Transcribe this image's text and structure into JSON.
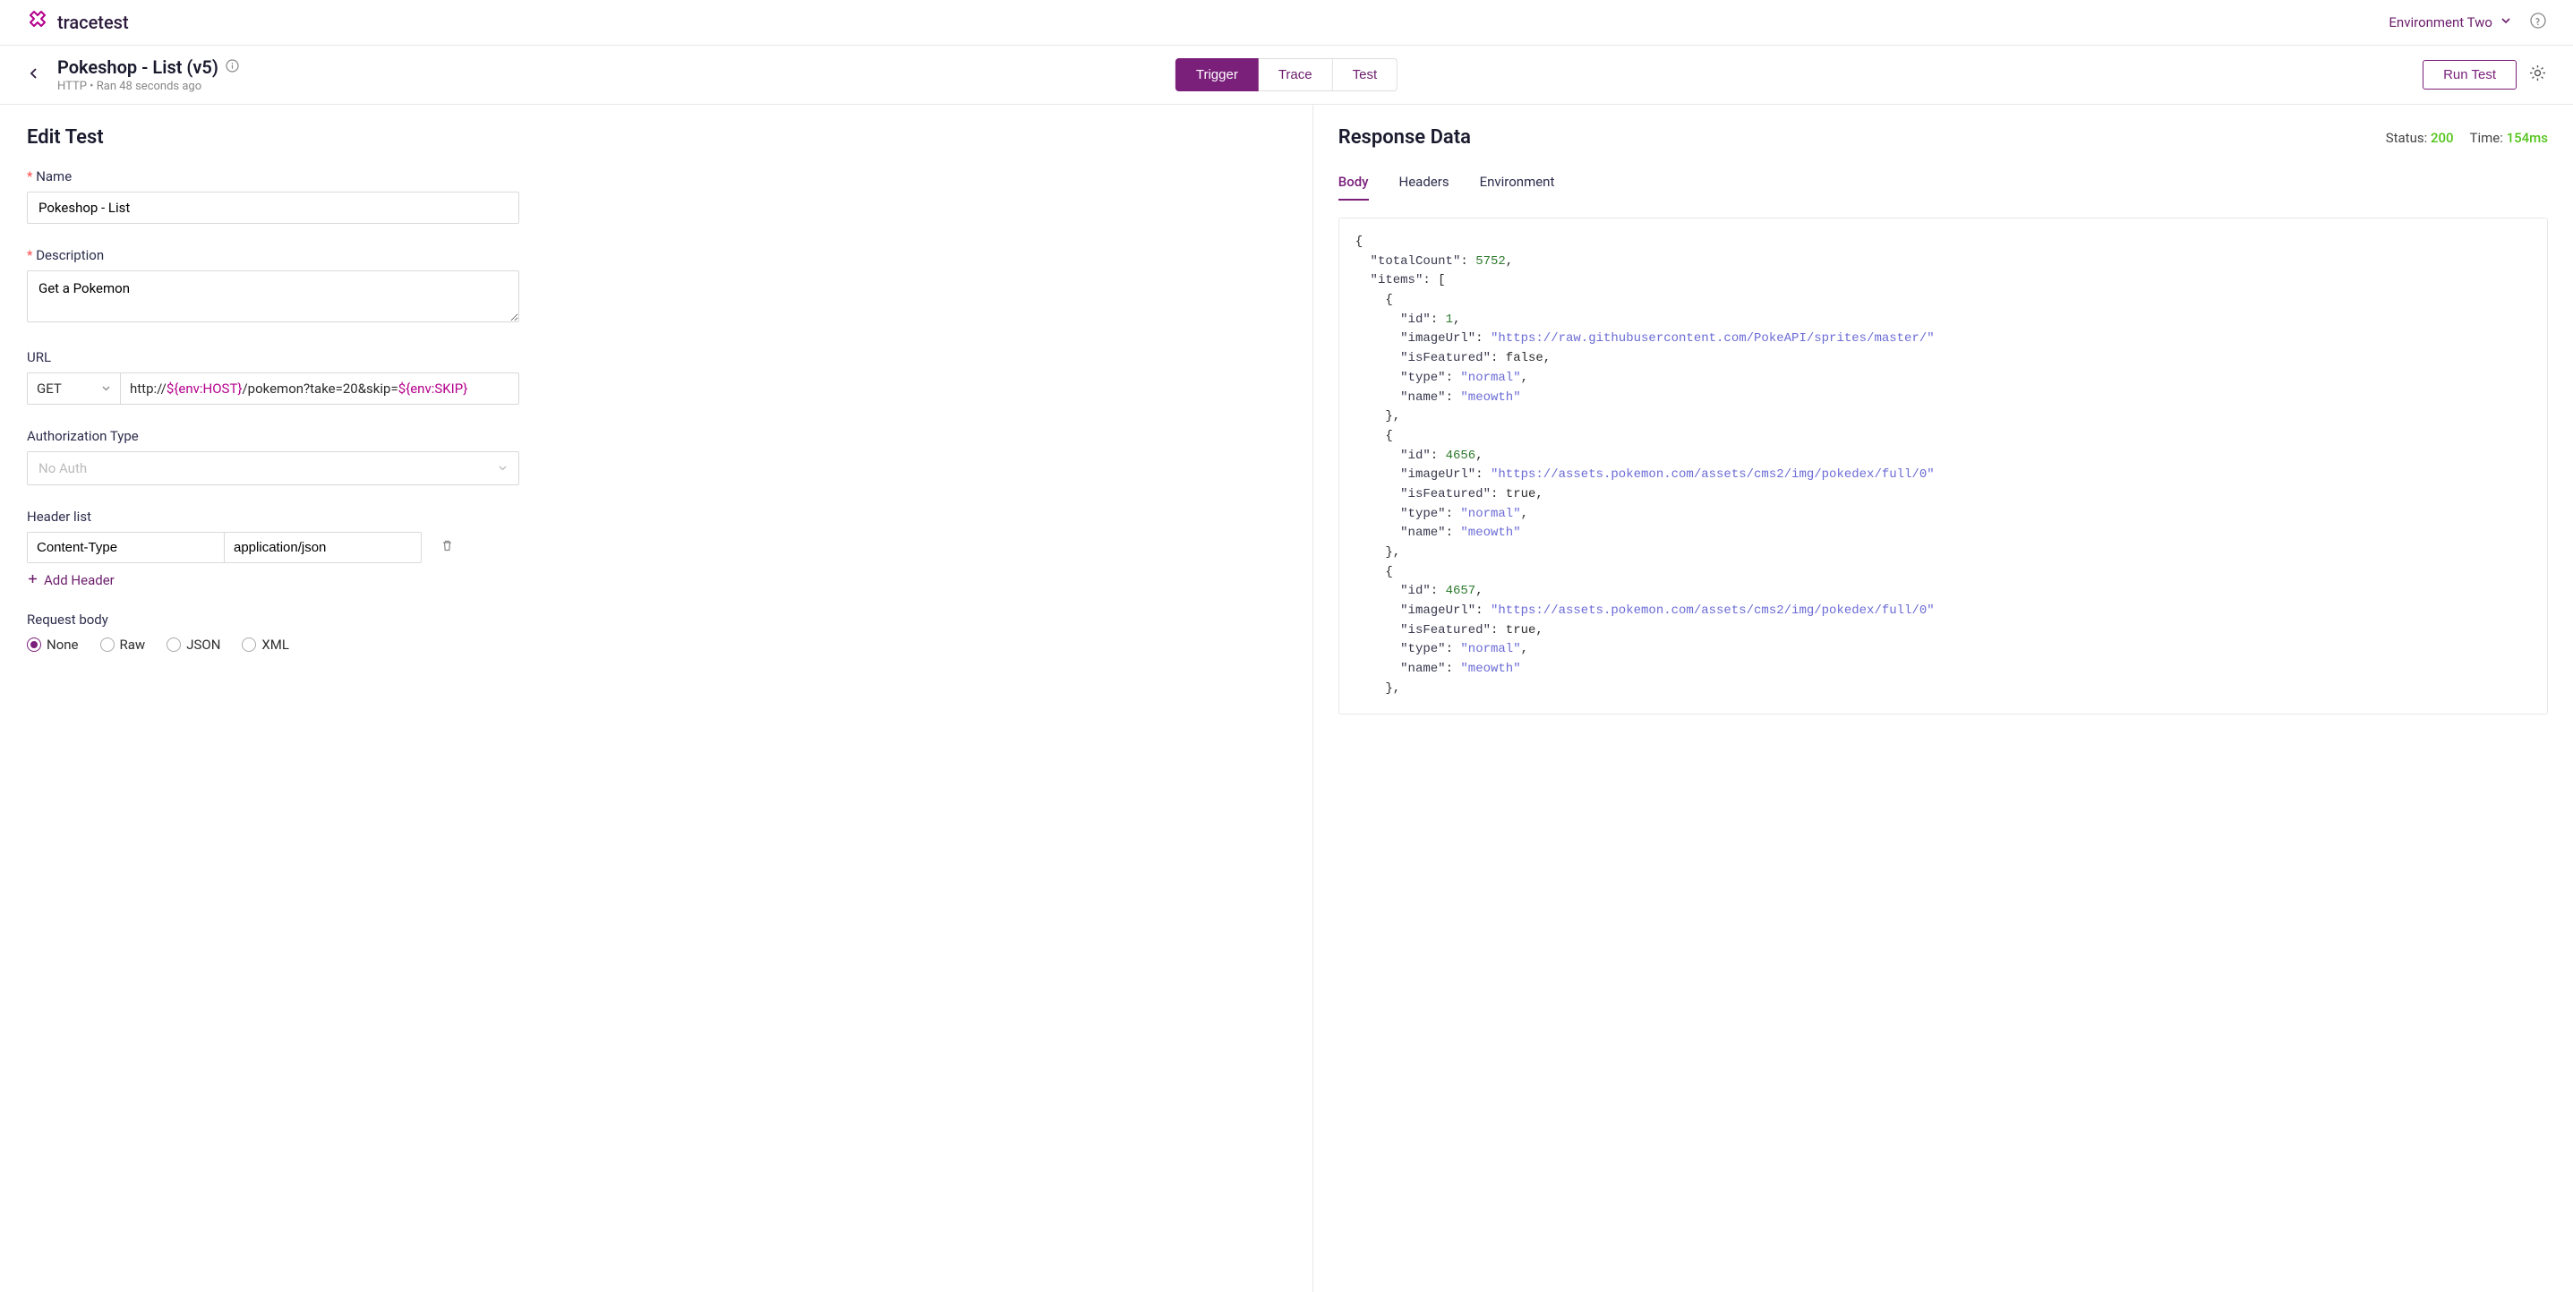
{
  "topbar": {
    "brand": "tracetest",
    "environment_label": "Environment Two"
  },
  "subheader": {
    "title": "Pokeshop - List (v5)",
    "meta_protocol": "HTTP",
    "meta_sep": "•",
    "meta_ran": "Ran 48 seconds ago",
    "run_button": "Run Test",
    "tabs": [
      "Trigger",
      "Trace",
      "Test"
    ]
  },
  "edit": {
    "title": "Edit Test",
    "name_label": "Name",
    "name_value": "Pokeshop - List",
    "desc_label": "Description",
    "desc_value": "Get a Pokemon",
    "url_label": "URL",
    "method": "GET",
    "url_prefix": "http://",
    "url_env1": "${env:HOST}",
    "url_mid": "/pokemon?take=20&skip=",
    "url_env2": "${env:SKIP}",
    "auth_label": "Authorization Type",
    "auth_value": "No Auth",
    "header_label": "Header list",
    "header_key": "Content-Type",
    "header_val": "application/json",
    "add_header": "Add Header",
    "body_label": "Request body",
    "body_options": [
      "None",
      "Raw",
      "JSON",
      "XML"
    ],
    "body_selected": "None"
  },
  "response": {
    "title": "Response Data",
    "status_label": "Status:",
    "status_value": "200",
    "time_label": "Time:",
    "time_value": "154ms",
    "tabs": [
      "Body",
      "Headers",
      "Environment"
    ],
    "body_code": "{\n  \"totalCount\": 5752,\n  \"items\": [\n    {\n      \"id\": 1,\n      \"imageUrl\": \"https://raw.githubusercontent.com/PokeAPI/sprites/master/\"\n      \"isFeatured\": false,\n      \"type\": \"normal\",\n      \"name\": \"meowth\"\n    },\n    {\n      \"id\": 4656,\n      \"imageUrl\": \"https://assets.pokemon.com/assets/cms2/img/pokedex/full/0\"\n      \"isFeatured\": true,\n      \"type\": \"normal\",\n      \"name\": \"meowth\"\n    },\n    {\n      \"id\": 4657,\n      \"imageUrl\": \"https://assets.pokemon.com/assets/cms2/img/pokedex/full/0\"\n      \"isFeatured\": true,\n      \"type\": \"normal\",\n      \"name\": \"meowth\"\n    },"
  }
}
